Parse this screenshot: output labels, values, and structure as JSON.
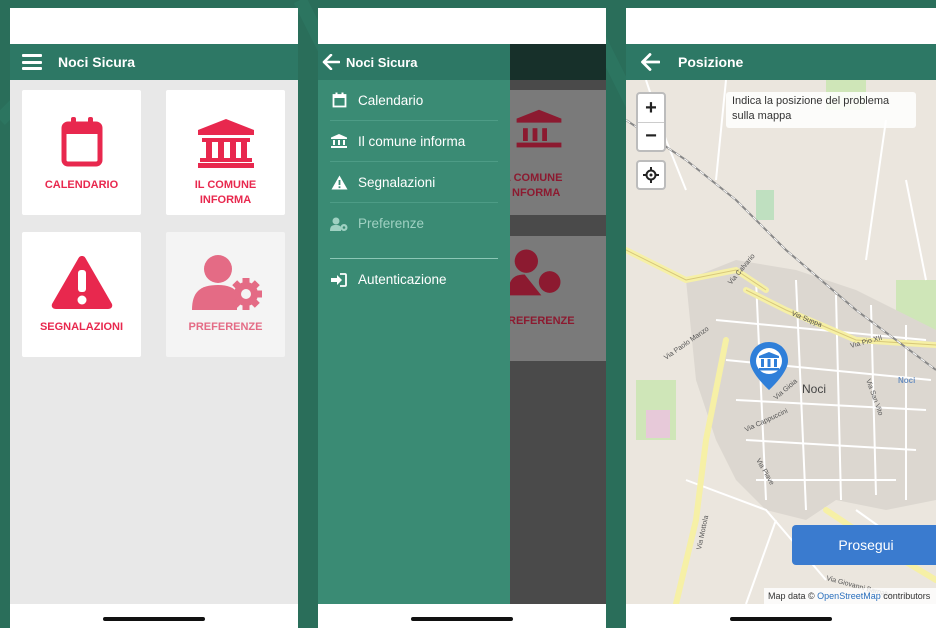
{
  "screen1": {
    "app_title": "Noci Sicura",
    "tiles": [
      {
        "label": "CALENDARIO",
        "icon": "calendar-icon"
      },
      {
        "label": "IL COMUNE INFORMA",
        "icon": "town-hall-icon"
      },
      {
        "label": "SEGNALAZIONI",
        "icon": "warning-icon"
      },
      {
        "label": "PREFERENZE",
        "icon": "user-settings-icon"
      }
    ]
  },
  "screen2": {
    "drawer_title": "Noci Sicura",
    "menu": [
      {
        "label": "Calendario",
        "icon": "calendar-icon"
      },
      {
        "label": "Il comune informa",
        "icon": "town-hall-icon"
      },
      {
        "label": "Segnalazioni",
        "icon": "warning-icon"
      },
      {
        "label": "Preferenze",
        "icon": "user-settings-icon"
      }
    ],
    "auth_label": "Autenticazione",
    "shade_labels": [
      "L COMUNE",
      "NFORMA",
      "REFERENZE"
    ]
  },
  "screen3": {
    "title": "Posizione",
    "zoom_in": "+",
    "zoom_out": "−",
    "hint": "Indica la posizione del problema sulla mappa",
    "button": "Prosegui",
    "attribution_prefix": "Map data © ",
    "attribution_link": "OpenStreetMap",
    "attribution_suffix": " contributors",
    "map_labels": {
      "town": "Noci",
      "town_right": "Noci",
      "streets": [
        "Via Suppa",
        "Via Pio XII",
        "Via Calvario",
        "Via Mottola",
        "Via Giovanni Barnaba",
        "Via Paolo Manzo",
        "Via Cappuccini",
        "Via Piave",
        "Via San Vito",
        "Via Gioia"
      ]
    }
  },
  "colors": {
    "primary": "#2d7865",
    "drawer": "#3a8b74",
    "accent": "#e8284e",
    "button": "#3a7bcf"
  }
}
